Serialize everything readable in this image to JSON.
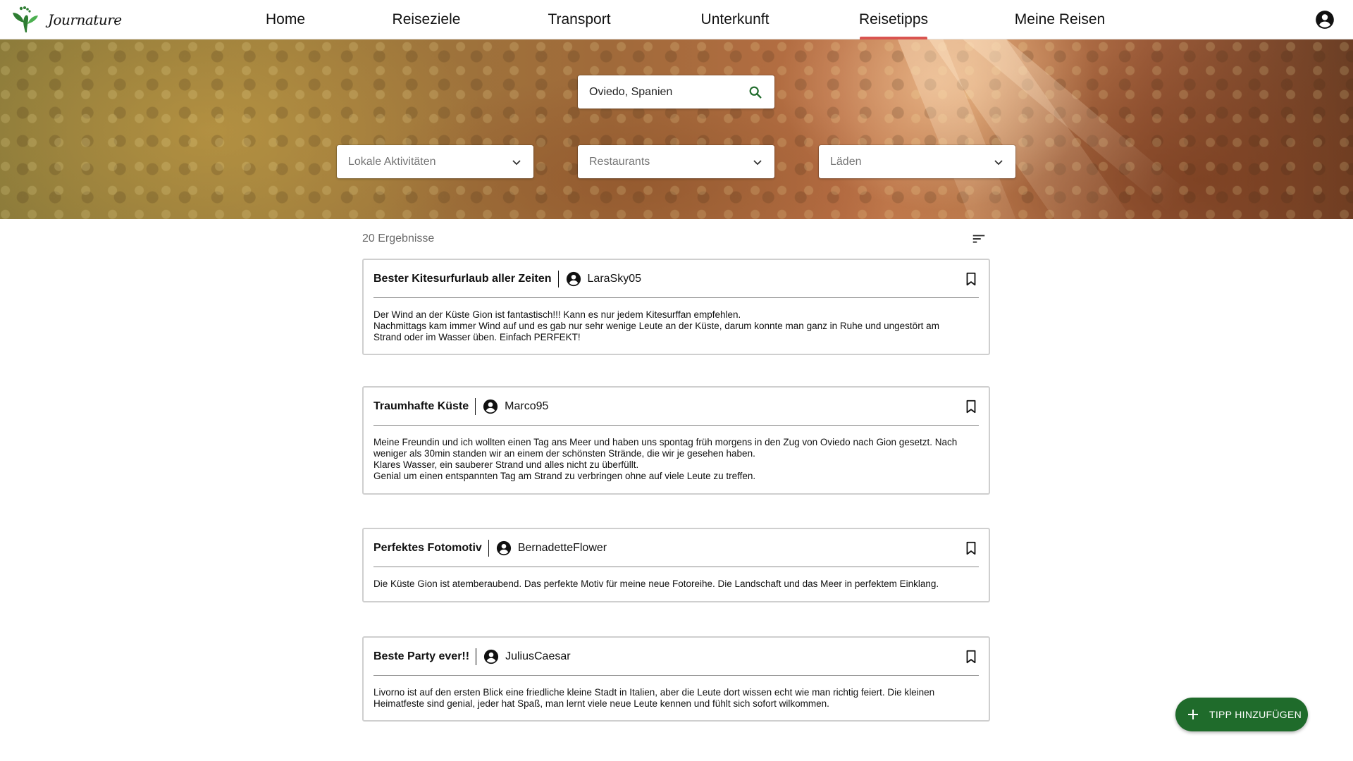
{
  "app": {
    "logo_text": "Journature"
  },
  "nav": {
    "items": [
      {
        "label": "Home",
        "active": false
      },
      {
        "label": "Reiseziele",
        "active": false
      },
      {
        "label": "Transport",
        "active": false
      },
      {
        "label": "Unterkunft",
        "active": false
      },
      {
        "label": "Reisetipps",
        "active": true
      },
      {
        "label": "Meine Reisen",
        "active": false
      }
    ],
    "account_icon": "account-circle-icon"
  },
  "search": {
    "value": "Oviedo, Spanien",
    "icon": "search-icon"
  },
  "filters": [
    {
      "placeholder": "Lokale Aktivitäten",
      "icon": "chevron-down-icon"
    },
    {
      "placeholder": "Restaurants",
      "icon": "chevron-down-icon"
    },
    {
      "placeholder": "Läden",
      "icon": "chevron-down-icon"
    }
  ],
  "results": {
    "count_label": "20 Ergebnisse",
    "sort_icon": "sort-icon"
  },
  "tips": [
    {
      "title": "Bester Kitesurfurlaub aller Zeiten",
      "user": "LaraSky05",
      "lines": [
        "Der Wind an der Küste Gion ist fantastisch!!! Kann es nur jedem Kitesurffan empfehlen.",
        "Nachmittags kam immer Wind auf und es gab nur sehr wenige Leute an der Küste, darum konnte man ganz in Ruhe und ungestört am",
        "Strand oder im Wasser üben. Einfach PERFEKT!"
      ]
    },
    {
      "title": "Traumhafte Küste",
      "user": "Marco95",
      "lines": [
        "Meine Freundin und ich wollten einen Tag ans Meer und haben uns spontag früh morgens in den Zug von Oviedo nach Gion gesetzt. Nach",
        "weniger als 30min standen wir an einem der schönsten Strände, die wir je gesehen haben.",
        "Klares Wasser, ein sauberer Strand und alles nicht zu überfüllt.",
        "Genial um einen entspannten Tag am Strand zu verbringen ohne auf viele Leute zu treffen."
      ]
    },
    {
      "title": "Perfektes Fotomotiv",
      "user": "BernadetteFlower",
      "lines": [
        "Die Küste Gion ist atemberaubend. Das perfekte Motiv für meine neue Fotoreihe. Die Landschaft und das Meer in perfektem Einklang."
      ]
    },
    {
      "title": "Beste Party ever!!",
      "user": "JuliusCaesar",
      "lines": [
        "Livorno ist auf den ersten Blick eine friedliche kleine Stadt in Italien, aber die Leute dort wissen echt wie man richtig feiert. Die kleinen",
        "Heimatfeste sind genial, jeder hat Spaß, man lernt viele neue Leute kennen und fühlt sich sofort wilkommen."
      ]
    }
  ],
  "fab": {
    "label": "TIPP HINZUFÜGEN",
    "icon": "plus-icon"
  },
  "colors": {
    "accent": "#d95450",
    "fab": "#1f6b2b",
    "logo_green": "#2e7d32"
  }
}
